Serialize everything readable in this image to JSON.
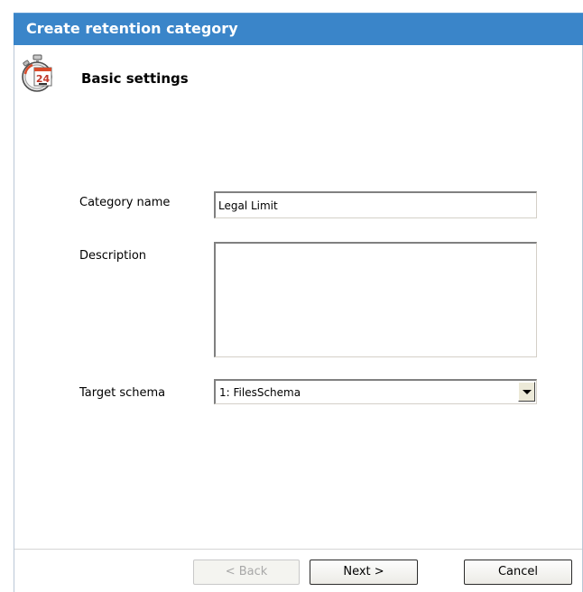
{
  "window": {
    "title": "Create retention category"
  },
  "header": {
    "icon": "stopwatch-24-icon",
    "section_title": "Basic settings"
  },
  "form": {
    "category_name_label": "Category name",
    "category_name_value": "Legal Limit",
    "description_label": "Description",
    "description_value": "",
    "target_schema_label": "Target schema",
    "target_schema_value": "1: FilesSchema"
  },
  "buttons": {
    "back_label": "< Back",
    "back_enabled": false,
    "next_label": "Next >",
    "cancel_label": "Cancel"
  },
  "colors": {
    "titlebar": "#3a85c9",
    "title_text": "#ffffff",
    "disabled_text": "#a8a8a8"
  }
}
